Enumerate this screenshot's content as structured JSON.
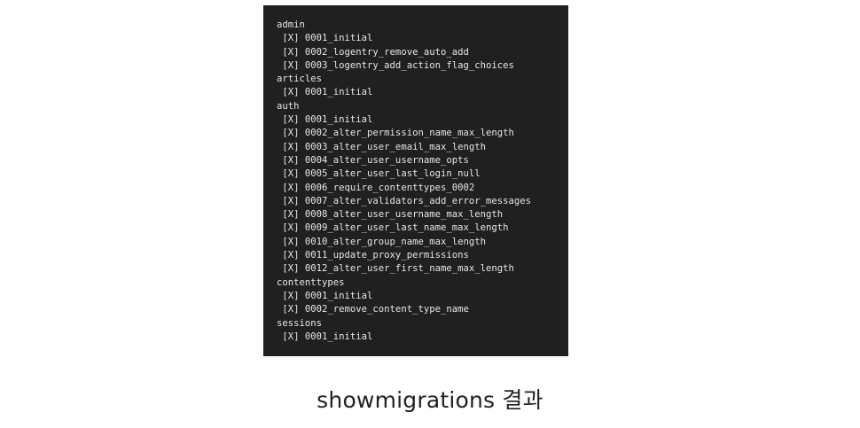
{
  "terminal": {
    "lines": [
      {
        "kind": "app",
        "text": "admin"
      },
      {
        "kind": "migration",
        "text": " [X] 0001_initial"
      },
      {
        "kind": "migration",
        "text": " [X] 0002_logentry_remove_auto_add"
      },
      {
        "kind": "migration",
        "text": " [X] 0003_logentry_add_action_flag_choices"
      },
      {
        "kind": "app",
        "text": "articles"
      },
      {
        "kind": "migration",
        "text": " [X] 0001_initial"
      },
      {
        "kind": "app",
        "text": "auth"
      },
      {
        "kind": "migration",
        "text": " [X] 0001_initial"
      },
      {
        "kind": "migration",
        "text": " [X] 0002_alter_permission_name_max_length"
      },
      {
        "kind": "migration",
        "text": " [X] 0003_alter_user_email_max_length"
      },
      {
        "kind": "migration",
        "text": " [X] 0004_alter_user_username_opts"
      },
      {
        "kind": "migration",
        "text": " [X] 0005_alter_user_last_login_null"
      },
      {
        "kind": "migration",
        "text": " [X] 0006_require_contenttypes_0002"
      },
      {
        "kind": "migration",
        "text": " [X] 0007_alter_validators_add_error_messages"
      },
      {
        "kind": "migration",
        "text": " [X] 0008_alter_user_username_max_length"
      },
      {
        "kind": "migration",
        "text": " [X] 0009_alter_user_last_name_max_length"
      },
      {
        "kind": "migration",
        "text": " [X] 0010_alter_group_name_max_length"
      },
      {
        "kind": "migration",
        "text": " [X] 0011_update_proxy_permissions"
      },
      {
        "kind": "migration",
        "text": " [X] 0012_alter_user_first_name_max_length"
      },
      {
        "kind": "app",
        "text": "contenttypes"
      },
      {
        "kind": "migration",
        "text": " [X] 0001_initial"
      },
      {
        "kind": "migration",
        "text": " [X] 0002_remove_content_type_name"
      },
      {
        "kind": "app",
        "text": "sessions"
      },
      {
        "kind": "migration",
        "text": " [X] 0001_initial"
      }
    ],
    "background_color": "#202020",
    "text_color": "#e6e6e6"
  },
  "caption": {
    "text": "showmigrations 결과"
  }
}
